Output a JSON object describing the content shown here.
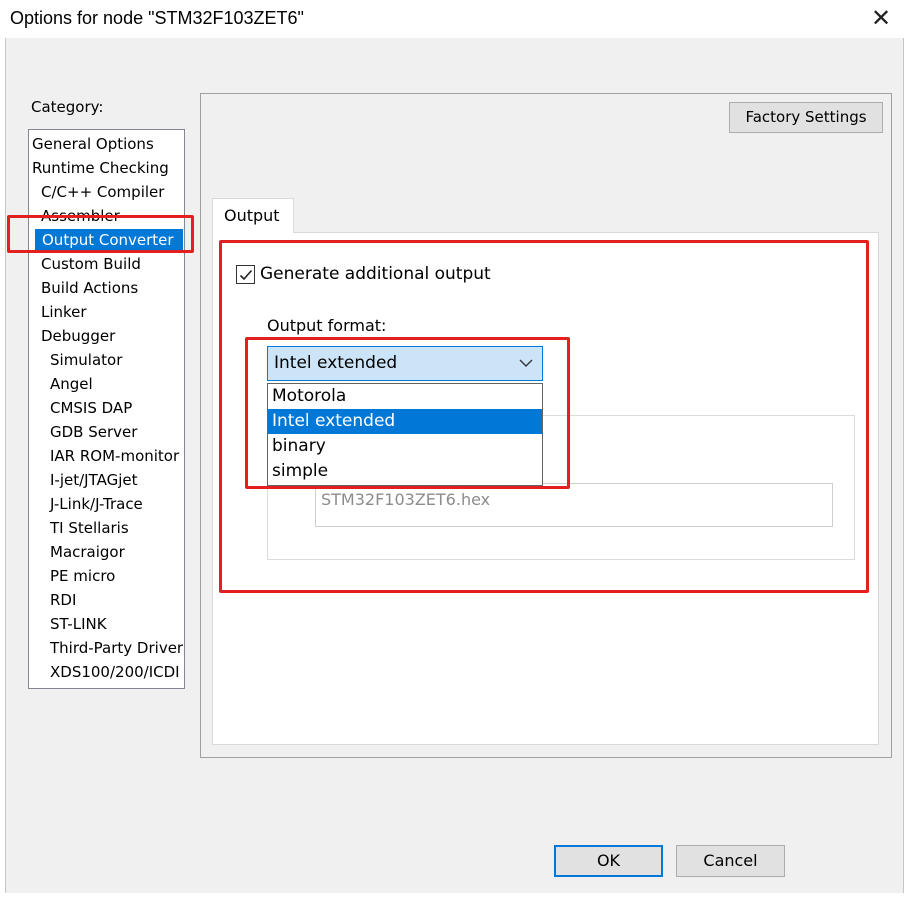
{
  "window": {
    "title": "Options for node \"STM32F103ZET6\"",
    "close_icon": "close-icon"
  },
  "category": {
    "label": "Category:",
    "items": [
      {
        "label": "General Options",
        "level": 0
      },
      {
        "label": "Runtime Checking",
        "level": 0
      },
      {
        "label": "C/C++ Compiler",
        "level": 1
      },
      {
        "label": "Assembler",
        "level": 1
      },
      {
        "label": "Output Converter",
        "level": 1,
        "selected": true
      },
      {
        "label": "Custom Build",
        "level": 1
      },
      {
        "label": "Build Actions",
        "level": 1
      },
      {
        "label": "Linker",
        "level": 1
      },
      {
        "label": "Debugger",
        "level": 1
      },
      {
        "label": "Simulator",
        "level": 2
      },
      {
        "label": "Angel",
        "level": 2
      },
      {
        "label": "CMSIS DAP",
        "level": 2
      },
      {
        "label": "GDB Server",
        "level": 2
      },
      {
        "label": "IAR ROM-monitor",
        "level": 2
      },
      {
        "label": "I-jet/JTAGjet",
        "level": 2
      },
      {
        "label": "J-Link/J-Trace",
        "level": 2
      },
      {
        "label": "TI Stellaris",
        "level": 2
      },
      {
        "label": "Macraigor",
        "level": 2
      },
      {
        "label": "PE micro",
        "level": 2
      },
      {
        "label": "RDI",
        "level": 2
      },
      {
        "label": "ST-LINK",
        "level": 2
      },
      {
        "label": "Third-Party Driver",
        "level": 2
      },
      {
        "label": "XDS100/200/ICDI",
        "level": 2
      }
    ]
  },
  "panel": {
    "factory_settings_label": "Factory Settings",
    "tabs": [
      {
        "label": "Output",
        "active": true
      }
    ],
    "generate_output": {
      "label": "Generate additional output",
      "checked": true
    },
    "output_format": {
      "label": "Output format:",
      "selected": "Intel extended",
      "options": [
        "Motorola",
        "Intel extended",
        "binary",
        "simple"
      ]
    },
    "output_file": {
      "value": "STM32F103ZET6.hex"
    }
  },
  "buttons": {
    "ok_label": "OK",
    "cancel_label": "Cancel"
  },
  "colors": {
    "selection": "#0078d7",
    "annotation": "#e32020",
    "dropdown_focus": "#cce4f7"
  }
}
